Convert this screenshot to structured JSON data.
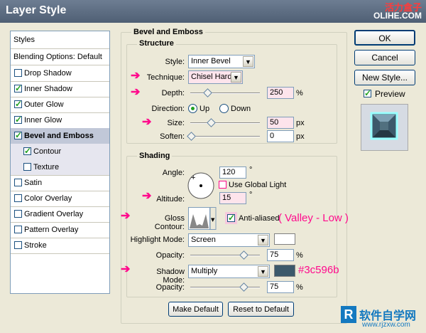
{
  "window": {
    "title": "Layer Style",
    "watermark_cn": "活力盒子",
    "watermark_en": "OLIHE.COM",
    "footer_watermark": "软件自学网",
    "footer_url": "www.rjzxw.com"
  },
  "styles_panel": {
    "header": "Styles",
    "blending": "Blending Options: Default",
    "items": [
      {
        "label": "Drop Shadow",
        "checked": false
      },
      {
        "label": "Inner Shadow",
        "checked": true
      },
      {
        "label": "Outer Glow",
        "checked": true
      },
      {
        "label": "Inner Glow",
        "checked": true
      },
      {
        "label": "Bevel and Emboss",
        "checked": true,
        "selected": true
      },
      {
        "label": "Contour",
        "checked": true,
        "sub": true
      },
      {
        "label": "Texture",
        "checked": false,
        "sub": true
      },
      {
        "label": "Satin",
        "checked": false
      },
      {
        "label": "Color Overlay",
        "checked": false
      },
      {
        "label": "Gradient Overlay",
        "checked": false
      },
      {
        "label": "Pattern Overlay",
        "checked": false
      },
      {
        "label": "Stroke",
        "checked": false
      }
    ]
  },
  "bevel": {
    "group_title": "Bevel and Emboss",
    "structure_title": "Structure",
    "style_label": "Style:",
    "style_value": "Inner Bevel",
    "technique_label": "Technique:",
    "technique_value": "Chisel Hard",
    "depth_label": "Depth:",
    "depth_value": "250",
    "depth_unit": "%",
    "direction_label": "Direction:",
    "dir_up": "Up",
    "dir_down": "Down",
    "size_label": "Size:",
    "size_value": "50",
    "size_unit": "px",
    "soften_label": "Soften:",
    "soften_value": "0",
    "soften_unit": "px",
    "shading_title": "Shading",
    "angle_label": "Angle:",
    "angle_value": "120",
    "deg": "°",
    "global_light": "Use Global Light",
    "altitude_label": "Altitude:",
    "altitude_value": "15",
    "gloss_label": "Gloss Contour:",
    "anti_aliased": "Anti-aliased",
    "gloss_annotation": "( Valley - Low )",
    "highlight_label": "Highlight Mode:",
    "highlight_value": "Screen",
    "highlight_color": "#ffffff",
    "opacity_label": "Opacity:",
    "highlight_opacity": "75",
    "pct": "%",
    "shadow_label": "Shadow Mode:",
    "shadow_value": "Multiply",
    "shadow_color": "#3c596b",
    "shadow_annotation": "#3c596b",
    "shadow_opacity": "75",
    "make_default": "Make Default",
    "reset_default": "Reset to Default"
  },
  "right": {
    "ok": "OK",
    "cancel": "Cancel",
    "new_style": "New Style...",
    "preview": "Preview"
  }
}
